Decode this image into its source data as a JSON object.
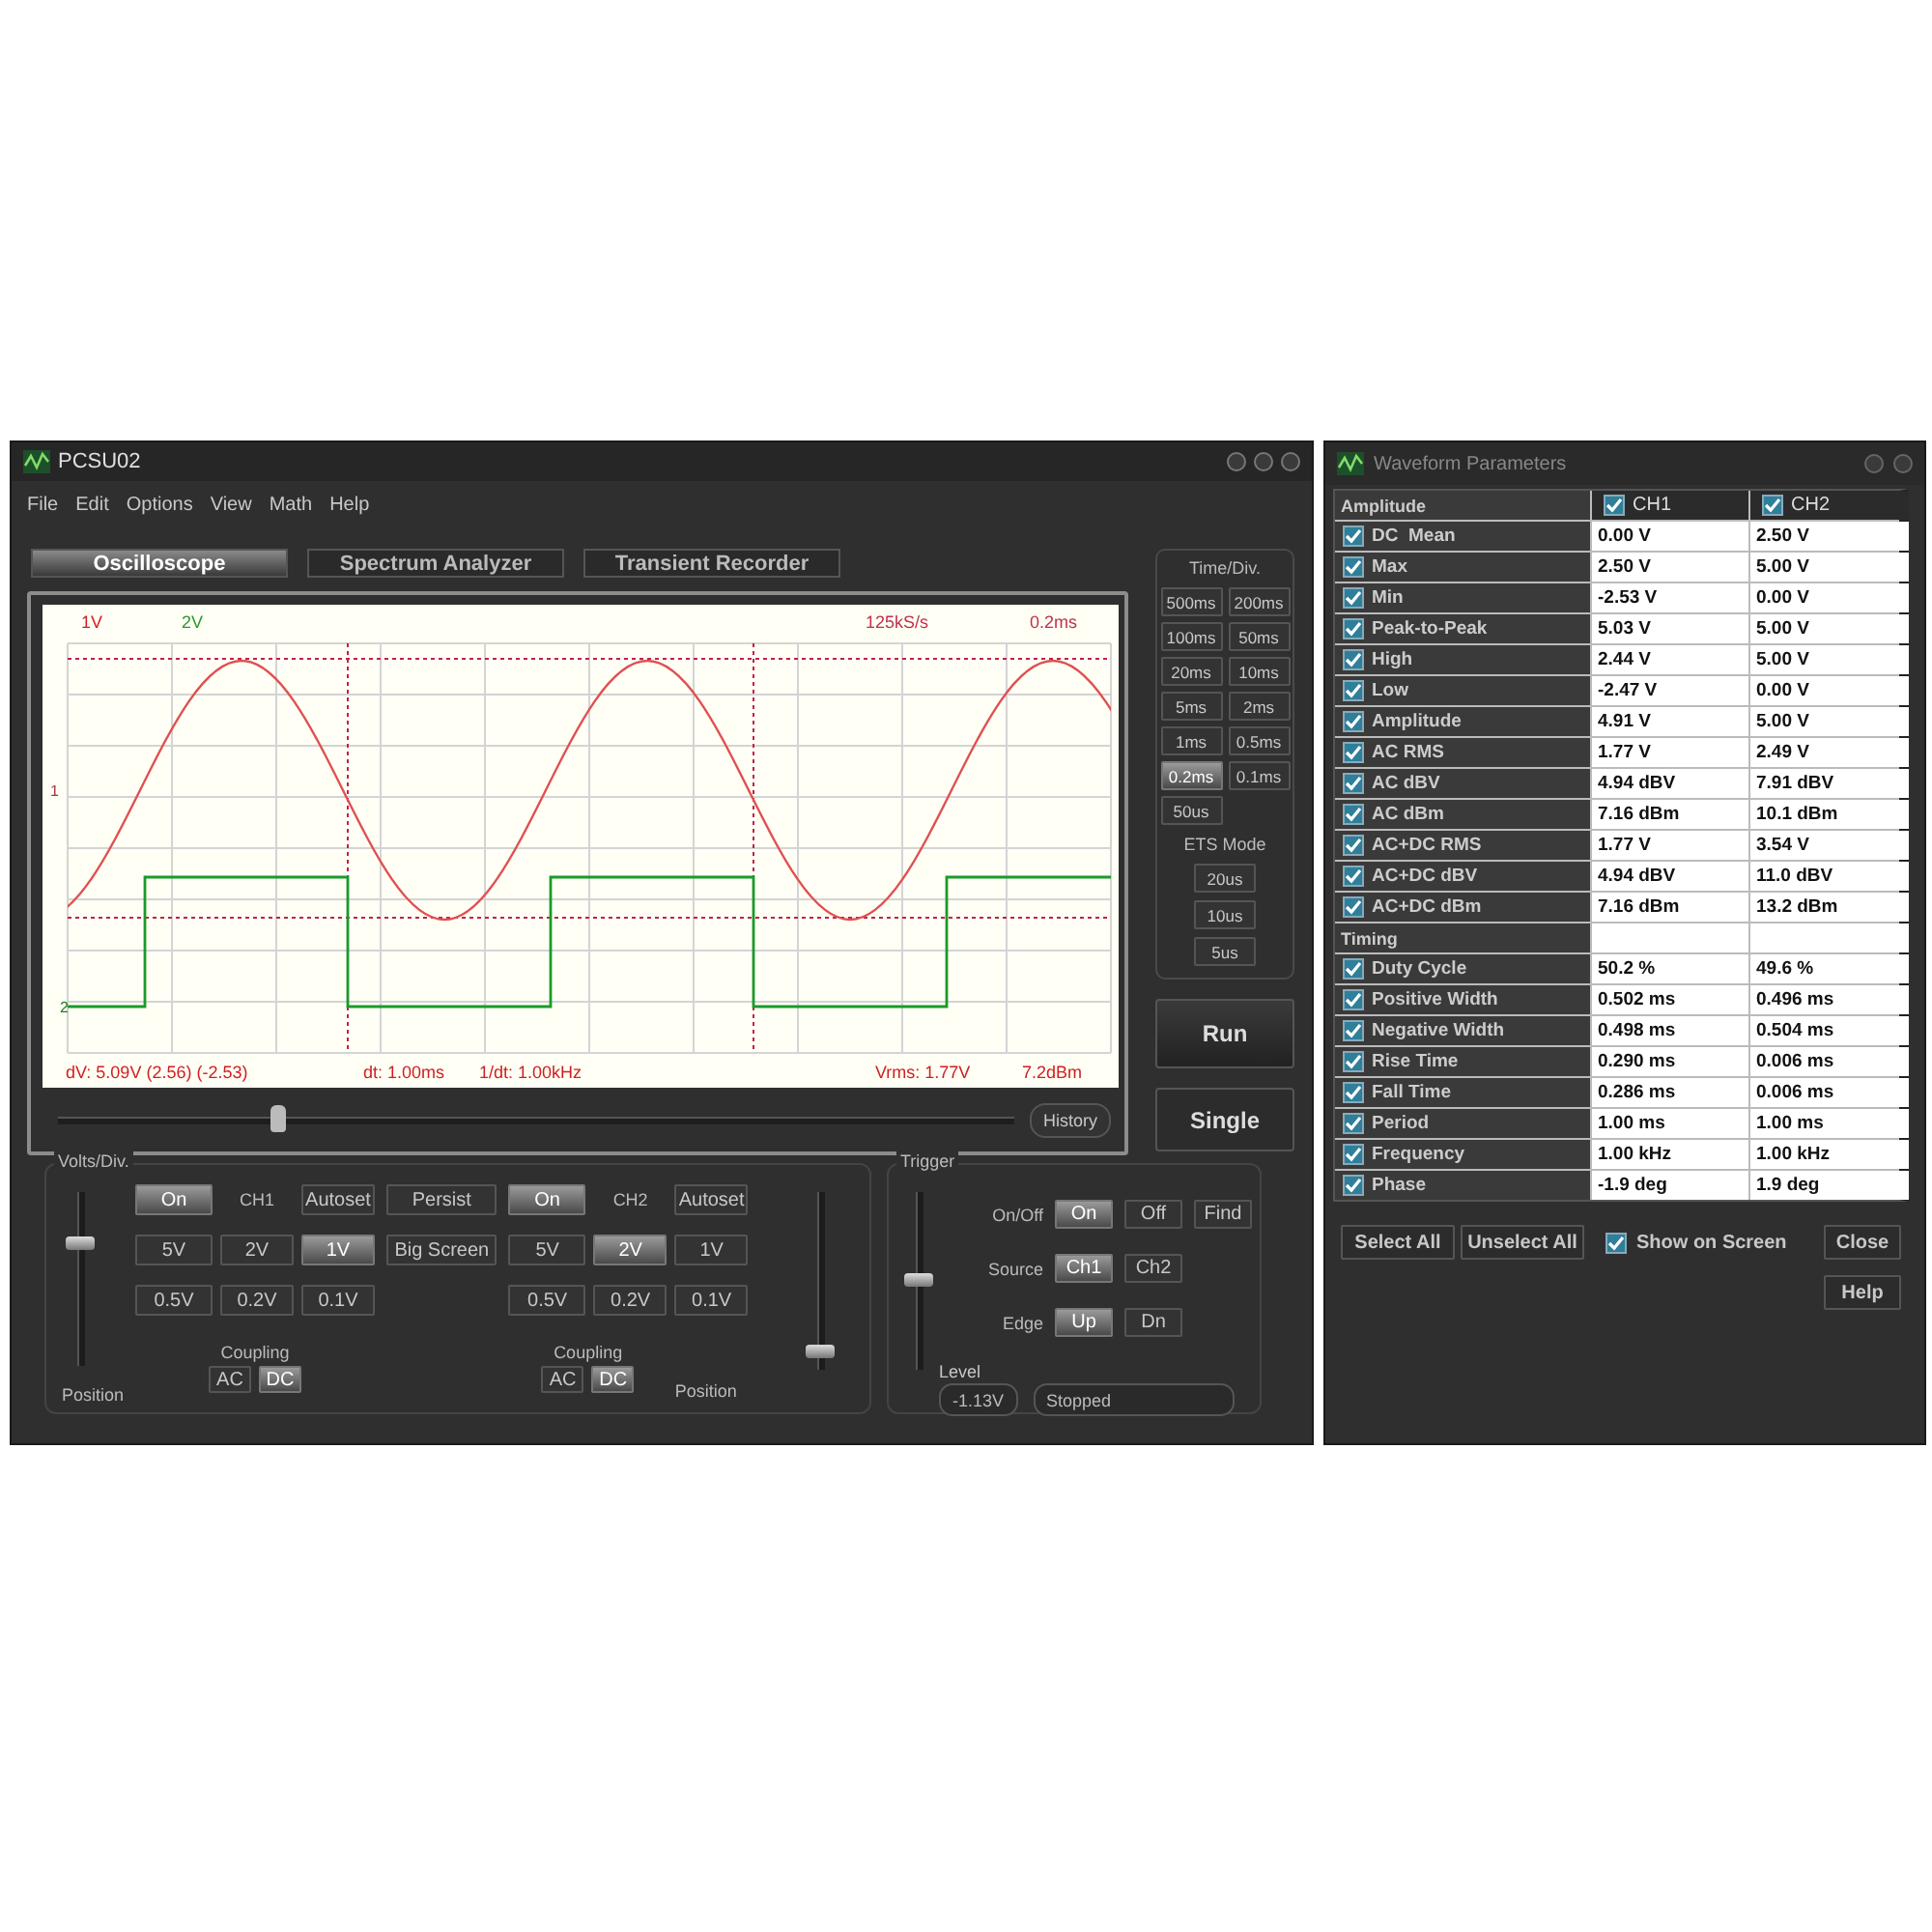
{
  "main_window": {
    "title": "PCSU02",
    "menu": [
      "File",
      "Edit",
      "Options",
      "View",
      "Math",
      "Help"
    ],
    "tabs": [
      {
        "label": "Oscilloscope",
        "selected": true
      },
      {
        "label": "Spectrum Analyzer",
        "selected": false
      },
      {
        "label": "Transient Recorder",
        "selected": false
      }
    ],
    "scope": {
      "ch1_scale": "1V",
      "ch2_scale": "2V",
      "sample_rate": "125kS/s",
      "timebase": "0.2ms",
      "ch1_marker": "1",
      "ch2_marker": "2",
      "readouts": [
        "dV: 5.09V (2.56) (-2.53)",
        "dt: 1.00ms",
        "1/dt: 1.00kHz",
        "Vrms: 1.77V",
        "7.2dBm"
      ],
      "scroll": {
        "level": 0.23
      },
      "history_button": "History"
    },
    "time_div": {
      "title": "Time/Div.",
      "buttons": [
        {
          "label": "500ms",
          "selected": false
        },
        {
          "label": "200ms",
          "selected": false
        },
        {
          "label": "100ms",
          "selected": false
        },
        {
          "label": "50ms",
          "selected": false
        },
        {
          "label": "20ms",
          "selected": false
        },
        {
          "label": "10ms",
          "selected": false
        },
        {
          "label": "5ms",
          "selected": false
        },
        {
          "label": "2ms",
          "selected": false
        },
        {
          "label": "1ms",
          "selected": false
        },
        {
          "label": "0.5ms",
          "selected": false
        },
        {
          "label": "0.2ms",
          "selected": true
        },
        {
          "label": "0.1ms",
          "selected": false
        },
        {
          "label": "50us",
          "selected": false
        }
      ],
      "ets_title": "ETS Mode",
      "ets_buttons": [
        {
          "label": "20us",
          "selected": false
        },
        {
          "label": "10us",
          "selected": false
        },
        {
          "label": "5us",
          "selected": false
        }
      ]
    },
    "run_button": "Run",
    "single_button": "Single",
    "volts_div": {
      "title": "Volts/Div.",
      "persist_button": "Persist",
      "big_screen_button": "Big Screen",
      "channels": [
        {
          "name": "CH1",
          "on_button": {
            "label": "On",
            "on": true
          },
          "autoset": "Autoset",
          "ranges": [
            {
              "label": "5V",
              "selected": false
            },
            {
              "label": "2V",
              "selected": false
            },
            {
              "label": "1V",
              "selected": true
            },
            {
              "label": "0.5V",
              "selected": false
            },
            {
              "label": "0.2V",
              "selected": false
            },
            {
              "label": "0.1V",
              "selected": false
            }
          ],
          "coupling_title": "Coupling",
          "coupling": [
            {
              "label": "AC",
              "selected": false
            },
            {
              "label": "DC",
              "selected": true
            }
          ],
          "position_label": "Position",
          "position": {
            "level": 0.7
          }
        },
        {
          "name": "CH2",
          "on_button": {
            "label": "On",
            "on": true
          },
          "autoset": "Autoset",
          "ranges": [
            {
              "label": "5V",
              "selected": false
            },
            {
              "label": "2V",
              "selected": true
            },
            {
              "label": "1V",
              "selected": false
            },
            {
              "label": "0.5V",
              "selected": false
            },
            {
              "label": "0.2V",
              "selected": false
            },
            {
              "label": "0.1V",
              "selected": false
            }
          ],
          "coupling_title": "Coupling",
          "coupling": [
            {
              "label": "AC",
              "selected": false
            },
            {
              "label": "DC",
              "selected": true
            }
          ],
          "position_label": "Position",
          "position": {
            "level": 0.1
          }
        }
      ]
    },
    "trigger": {
      "title": "Trigger",
      "rows": [
        {
          "label": "On/Off",
          "options": [
            {
              "label": "On",
              "selected": true
            },
            {
              "label": "Off",
              "selected": false
            }
          ]
        },
        {
          "label": "Source",
          "options": [
            {
              "label": "Ch1",
              "selected": true
            },
            {
              "label": "Ch2",
              "selected": false
            }
          ]
        },
        {
          "label": "Edge",
          "options": [
            {
              "label": "Up",
              "selected": true
            },
            {
              "label": "Dn",
              "selected": false
            }
          ]
        }
      ],
      "find_button": "Find",
      "level_label": "Level",
      "level_value": "-1.13V",
      "level": {
        "level": 0.5
      },
      "status": "Stopped"
    }
  },
  "parameters_window": {
    "title": "Waveform Parameters",
    "columns": [
      {
        "label": "CH1",
        "checked": true
      },
      {
        "label": "CH2",
        "checked": true
      }
    ],
    "sections": [
      {
        "title": "Amplitude",
        "rows": [
          {
            "label": "DC  Mean",
            "checked": true,
            "ch1": "0.00 V",
            "ch2": "2.50 V"
          },
          {
            "label": "Max",
            "checked": true,
            "ch1": "2.50 V",
            "ch2": "5.00 V"
          },
          {
            "label": "Min",
            "checked": true,
            "ch1": "-2.53 V",
            "ch2": "0.00 V"
          },
          {
            "label": "Peak-to-Peak",
            "checked": true,
            "ch1": "5.03 V",
            "ch2": "5.00 V"
          },
          {
            "label": "High",
            "checked": true,
            "ch1": "2.44 V",
            "ch2": "5.00 V"
          },
          {
            "label": "Low",
            "checked": true,
            "ch1": "-2.47 V",
            "ch2": "0.00 V"
          },
          {
            "label": "Amplitude",
            "checked": true,
            "ch1": "4.91 V",
            "ch2": "5.00 V"
          },
          {
            "label": "AC RMS",
            "checked": true,
            "ch1": "1.77 V",
            "ch2": "2.49 V"
          },
          {
            "label": "AC dBV",
            "checked": true,
            "ch1": "4.94 dBV",
            "ch2": "7.91 dBV"
          },
          {
            "label": "AC dBm",
            "checked": true,
            "ch1": "7.16 dBm",
            "ch2": "10.1 dBm"
          },
          {
            "label": "AC+DC RMS",
            "checked": true,
            "ch1": "1.77 V",
            "ch2": "3.54 V"
          },
          {
            "label": "AC+DC dBV",
            "checked": true,
            "ch1": "4.94 dBV",
            "ch2": "11.0 dBV"
          },
          {
            "label": "AC+DC dBm",
            "checked": true,
            "ch1": "7.16 dBm",
            "ch2": "13.2 dBm"
          }
        ]
      },
      {
        "title": "Timing",
        "rows": [
          {
            "label": "Duty Cycle",
            "checked": true,
            "ch1": "50.2 %",
            "ch2": "49.6 %"
          },
          {
            "label": "Positive Width",
            "checked": true,
            "ch1": "0.502 ms",
            "ch2": "0.496 ms"
          },
          {
            "label": "Negative Width",
            "checked": true,
            "ch1": "0.498 ms",
            "ch2": "0.504 ms"
          },
          {
            "label": "Rise Time",
            "checked": true,
            "ch1": "0.290 ms",
            "ch2": "0.006 ms"
          },
          {
            "label": "Fall Time",
            "checked": true,
            "ch1": "0.286 ms",
            "ch2": "0.006 ms"
          },
          {
            "label": "Period",
            "checked": true,
            "ch1": "1.00 ms",
            "ch2": "1.00 ms"
          },
          {
            "label": "Frequency",
            "checked": true,
            "ch1": "1.00 kHz",
            "ch2": "1.00 kHz"
          },
          {
            "label": "Phase",
            "checked": true,
            "ch1": "-1.9 deg",
            "ch2": "1.9 deg"
          }
        ]
      }
    ],
    "select_all_button": "Select All",
    "unselect_all_button": "Unselect All",
    "show_on_screen": {
      "label": "Show on Screen",
      "checked": true
    },
    "close_button": "Close",
    "help_button": "Help"
  }
}
